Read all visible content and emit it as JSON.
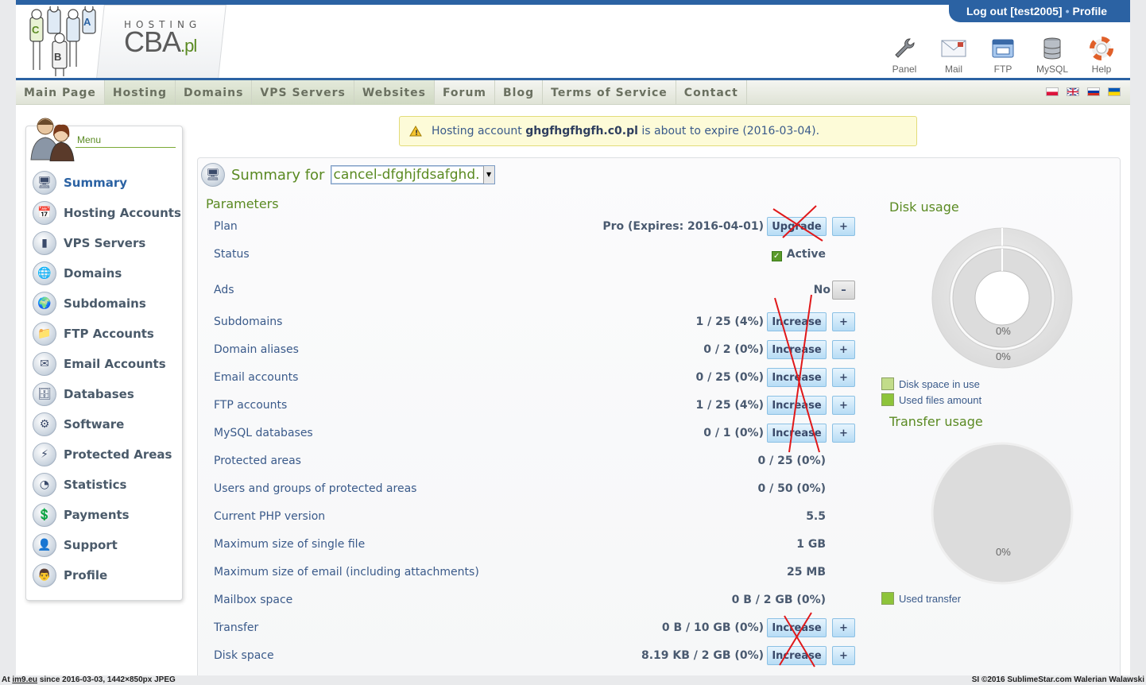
{
  "header": {
    "brand_small": "HOSTING",
    "brand_main": "CBA",
    "brand_tld": ".pl",
    "logout_label": "Log out [test2005]",
    "profile_label": "Profile",
    "tools": [
      {
        "label": "Panel",
        "icon": "wrench-icon"
      },
      {
        "label": "Mail",
        "icon": "mail-icon"
      },
      {
        "label": "FTP",
        "icon": "ftp-icon"
      },
      {
        "label": "MySQL",
        "icon": "database-icon"
      },
      {
        "label": "Help",
        "icon": "lifebuoy-icon"
      }
    ]
  },
  "nav": [
    "Main Page",
    "Hosting",
    "Domains",
    "VPS Servers",
    "Websites",
    "Forum",
    "Blog",
    "Terms of Service",
    "Contact"
  ],
  "sidebar": {
    "title": "Menu",
    "items": [
      "Summary",
      "Hosting Accounts",
      "VPS Servers",
      "Domains",
      "Subdomains",
      "FTP Accounts",
      "Email Accounts",
      "Databases",
      "Software",
      "Protected Areas",
      "Statistics",
      "Payments",
      "Support",
      "Profile"
    ]
  },
  "notice": {
    "pre": "Hosting account",
    "account": "ghgfhgfhgfh.c0.pl",
    "post": "is about to expire (2016-03-04)."
  },
  "summary": {
    "title": "Summary for",
    "selected_account": "cancel-dfghjfdsafghd.",
    "params_title": "Parameters",
    "upgrade_label": "Upgrade",
    "increase_label": "Increase",
    "plus_label": "+",
    "minus_label": "–",
    "plan": {
      "label": "Plan",
      "value": "Pro (Expires: 2016-04-01)"
    },
    "status": {
      "label": "Status",
      "value": "Active"
    },
    "ads": {
      "label": "Ads",
      "value": "No"
    },
    "rows": [
      {
        "label": "Subdomains",
        "value": "1 / 25 (4%)"
      },
      {
        "label": "Domain aliases",
        "value": "0 / 2 (0%)"
      },
      {
        "label": "Email accounts",
        "value": "0 / 25 (0%)"
      },
      {
        "label": "FTP accounts",
        "value": "1 / 25 (4%)"
      },
      {
        "label": "MySQL databases",
        "value": "0 / 1 (0%)"
      },
      {
        "label": "Protected areas",
        "value": "0 / 25 (0%)"
      },
      {
        "label": "Users and groups of protected areas",
        "value": "0 / 50 (0%)"
      },
      {
        "label": "Current PHP version",
        "value": "5.5"
      },
      {
        "label": "Maximum size of single file",
        "value": "1 GB"
      },
      {
        "label": "Maximum size of email (including attachments)",
        "value": "25 MB"
      },
      {
        "label": "Mailbox space",
        "value": "0 B / 2 GB (0%)"
      },
      {
        "label": "Transfer",
        "value": "0 B / 10 GB (0%)"
      },
      {
        "label": "Disk space",
        "value": "8.19 KB / 2 GB (0%)"
      }
    ]
  },
  "disk_usage": {
    "title": "Disk usage",
    "inner_pct": "0%",
    "outer_pct": "0%",
    "legend": [
      "Disk space in use",
      "Used files amount"
    ],
    "colors": [
      "#c2dc8a",
      "#8ec43a"
    ]
  },
  "transfer_usage": {
    "title": "Transfer usage",
    "pct": "0%",
    "legend": [
      "Used transfer"
    ],
    "color": "#8ec43a"
  },
  "footer": {
    "left_pre": "At",
    "left_link": "im9.eu",
    "left_post": "since 2016-03-03, 1442×850px JPEG",
    "right": "SI ©2016 SublimeStar.com Walerian Walawski"
  }
}
